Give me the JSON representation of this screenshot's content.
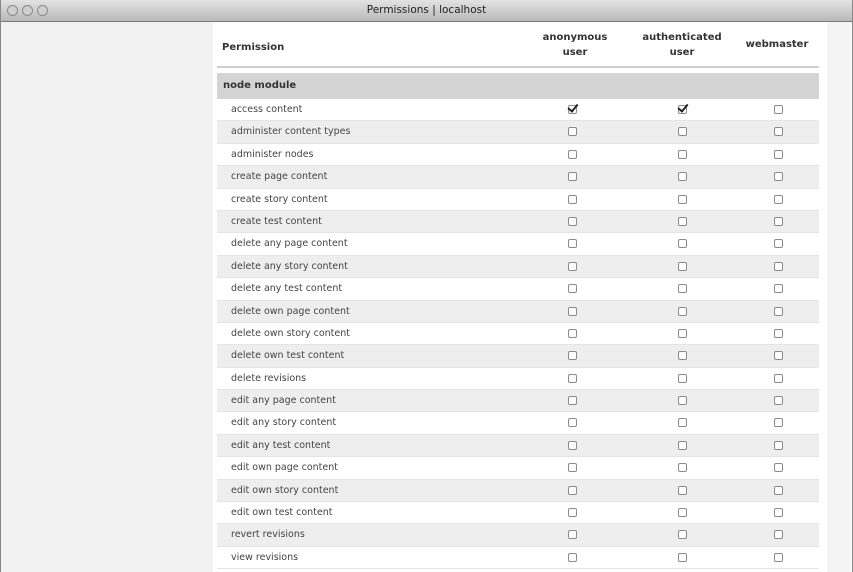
{
  "window": {
    "title": "Permissions | localhost"
  },
  "table": {
    "headers": {
      "permission": "Permission",
      "anonymous_line1": "anonymous",
      "anonymous_line2": "user",
      "authenticated_line1": "authenticated",
      "authenticated_line2": "user",
      "webmaster": "webmaster"
    },
    "module": "node module",
    "rows": [
      {
        "label": "access content",
        "anonymous": true,
        "authenticated": true,
        "webmaster": false
      },
      {
        "label": "administer content types",
        "anonymous": false,
        "authenticated": false,
        "webmaster": false
      },
      {
        "label": "administer nodes",
        "anonymous": false,
        "authenticated": false,
        "webmaster": false
      },
      {
        "label": "create page content",
        "anonymous": false,
        "authenticated": false,
        "webmaster": false
      },
      {
        "label": "create story content",
        "anonymous": false,
        "authenticated": false,
        "webmaster": false
      },
      {
        "label": "create test content",
        "anonymous": false,
        "authenticated": false,
        "webmaster": false
      },
      {
        "label": "delete any page content",
        "anonymous": false,
        "authenticated": false,
        "webmaster": false
      },
      {
        "label": "delete any story content",
        "anonymous": false,
        "authenticated": false,
        "webmaster": false
      },
      {
        "label": "delete any test content",
        "anonymous": false,
        "authenticated": false,
        "webmaster": false
      },
      {
        "label": "delete own page content",
        "anonymous": false,
        "authenticated": false,
        "webmaster": false
      },
      {
        "label": "delete own story content",
        "anonymous": false,
        "authenticated": false,
        "webmaster": false
      },
      {
        "label": "delete own test content",
        "anonymous": false,
        "authenticated": false,
        "webmaster": false
      },
      {
        "label": "delete revisions",
        "anonymous": false,
        "authenticated": false,
        "webmaster": false
      },
      {
        "label": "edit any page content",
        "anonymous": false,
        "authenticated": false,
        "webmaster": false
      },
      {
        "label": "edit any story content",
        "anonymous": false,
        "authenticated": false,
        "webmaster": false
      },
      {
        "label": "edit any test content",
        "anonymous": false,
        "authenticated": false,
        "webmaster": false
      },
      {
        "label": "edit own page content",
        "anonymous": false,
        "authenticated": false,
        "webmaster": false
      },
      {
        "label": "edit own story content",
        "anonymous": false,
        "authenticated": false,
        "webmaster": false
      },
      {
        "label": "edit own test content",
        "anonymous": false,
        "authenticated": false,
        "webmaster": false
      },
      {
        "label": "revert revisions",
        "anonymous": false,
        "authenticated": false,
        "webmaster": false
      },
      {
        "label": "view revisions",
        "anonymous": false,
        "authenticated": false,
        "webmaster": false
      }
    ]
  }
}
